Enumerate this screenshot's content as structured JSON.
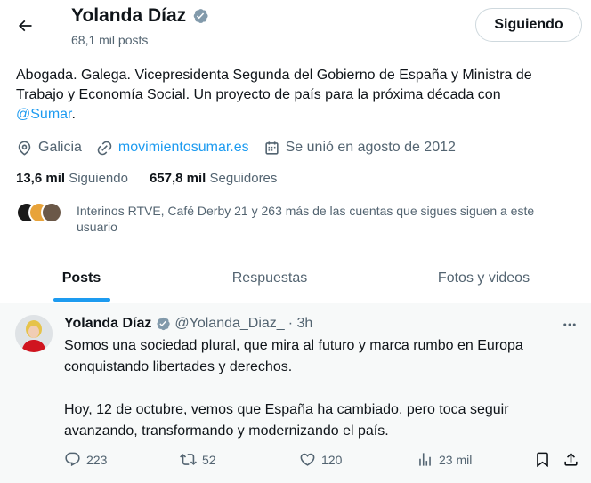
{
  "profile": {
    "name": "Yolanda Díaz",
    "posts_count": "68,1 mil posts",
    "follow_button": "Siguiendo",
    "bio_text": "Abogada. Galega. Vicepresidenta Segunda del Gobierno de España y Ministra de Trabajo y Economía Social. Un proyecto de país para la próxima década con ",
    "bio_mention": "@Sumar",
    "bio_end": ".",
    "location": "Galicia",
    "website": "movimientosumar.es",
    "joined": "Se unió en agosto de 2012",
    "following_count": "13,6 mil",
    "following_label": "Siguiendo",
    "followers_count": "657,8 mil",
    "followers_label": "Seguidores",
    "known_followers": "Interinos RTVE, Café Derby 21 y 263 más de las cuentas que sigues siguen a este usuario"
  },
  "tabs": [
    "Posts",
    "Respuestas",
    "Fotos y videos"
  ],
  "tweet": {
    "name": "Yolanda Díaz",
    "handle": "@Yolanda_Diaz_",
    "time": "· 3h",
    "paragraph1": "Somos una sociedad plural, que mira al futuro y marca rumbo en Europa conquistando libertades y derechos.",
    "paragraph2": "Hoy, 12 de octubre, vemos que España ha cambiado, pero toca seguir avanzando, transformando y modernizando el país.",
    "replies": "223",
    "reposts": "52",
    "likes": "120",
    "views": "23 mil"
  },
  "colors": {
    "accent": "#1d9bf0",
    "text": "#0f1419",
    "secondary": "#536471",
    "tweet_bg": "#f7f9f9"
  },
  "icons": [
    "back-arrow-icon",
    "verified-badge-icon",
    "location-icon",
    "link-icon",
    "calendar-icon",
    "more-icon",
    "reply-icon",
    "repost-icon",
    "like-icon",
    "views-icon",
    "bookmark-icon",
    "share-icon"
  ]
}
